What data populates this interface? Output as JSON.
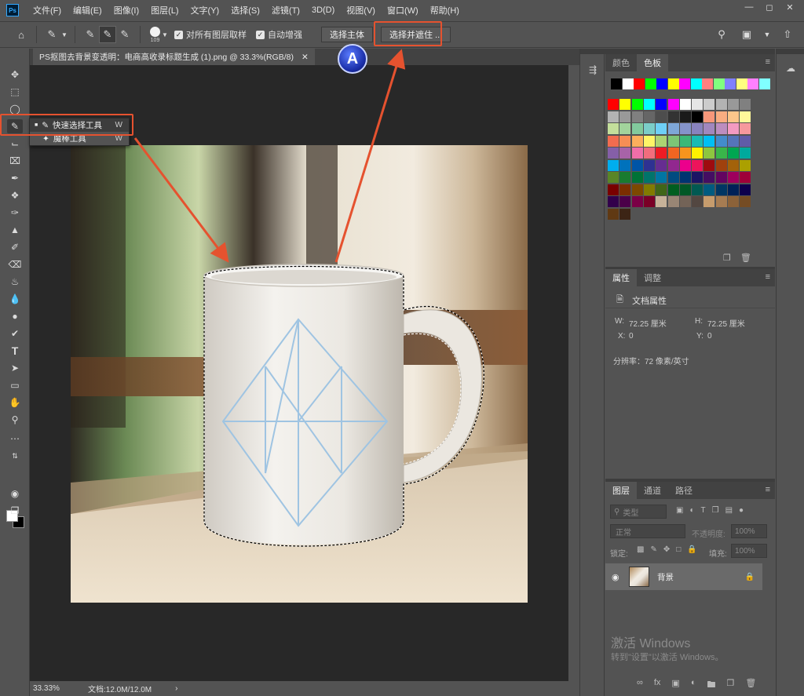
{
  "menu": {
    "app_icon": "Ps",
    "items": [
      "文件(F)",
      "编辑(E)",
      "图像(I)",
      "图层(L)",
      "文字(Y)",
      "选择(S)",
      "滤镜(T)",
      "3D(D)",
      "视图(V)",
      "窗口(W)",
      "帮助(H)"
    ]
  },
  "options": {
    "brush_size": "109",
    "sample_all_label": "对所有图层取样",
    "auto_enhance_label": "自动增强",
    "select_subject_label": "选择主体",
    "select_mask_label": "选择并遮住 ..."
  },
  "document": {
    "tab_title": "PS抠图去背景变透明：电商高收录标题生成 (1).png @ 33.3%(RGB/8)",
    "zoom": "33.33%",
    "doc_size": "文档:12.0M/12.0M"
  },
  "flyout": {
    "items": [
      {
        "label": "快速选择工具",
        "key": "W"
      },
      {
        "label": "魔棒工具",
        "key": "W"
      }
    ]
  },
  "badge_letter": "A",
  "swatches_panel": {
    "tabs": [
      "颜色",
      "色板"
    ],
    "active_tab": "色板"
  },
  "properties_panel": {
    "tabs": [
      "属性",
      "调整"
    ],
    "active_tab": "属性",
    "section_title": "文档属性",
    "w_label": "W:",
    "w_value": "72.25 厘米",
    "h_label": "H:",
    "h_value": "72.25 厘米",
    "x_label": "X:",
    "x_value": "0",
    "y_label": "Y:",
    "y_value": "0",
    "resolution": "分辨率：72 像素/英寸"
  },
  "layers_panel": {
    "tabs": [
      "图层",
      "通道",
      "路径"
    ],
    "active_tab": "图层",
    "filter_label": "类型",
    "blend_mode": "正常",
    "opacity_label": "不透明度:",
    "opacity_value": "100%",
    "lock_label": "锁定:",
    "fill_label": "填充:",
    "fill_value": "100%",
    "layer_name": "背景"
  },
  "watermark": {
    "line1": "激活 Windows",
    "line2": "转到\"设置\"以激活 Windows。"
  },
  "colors": {
    "accent_red": "#e5522f",
    "panel_bg": "#535353",
    "canvas_bg": "#282828"
  }
}
